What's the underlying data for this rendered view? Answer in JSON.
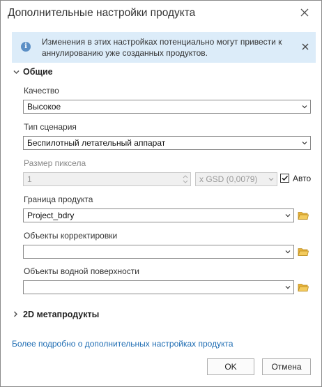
{
  "dialog": {
    "title": "Дополнительные настройки продукта",
    "close_icon": "close-icon"
  },
  "banner": {
    "icon": "info-icon",
    "text": "Изменения в этих настройках потенциально могут привести к аннулированию уже созданных продуктов.",
    "close_icon": "close-icon",
    "background": "#dcecf9"
  },
  "general": {
    "header": "Общие",
    "expanded": true,
    "quality": {
      "label": "Качество",
      "value": "Высокое"
    },
    "scenario": {
      "label": "Тип сценария",
      "value": "Беспилотный летательный аппарат"
    },
    "pixel_size": {
      "label": "Размер пиксела",
      "value": "1",
      "unit": "x GSD (0,0079)",
      "auto_label": "Авто",
      "auto_checked": true
    },
    "boundary": {
      "label": "Граница продукта",
      "value": "Project_bdry"
    },
    "correction": {
      "label": "Объекты корректировки",
      "value": ""
    },
    "water": {
      "label": "Объекты водной поверхности",
      "value": ""
    }
  },
  "metaproducts": {
    "header": "2D метапродукты",
    "expanded": false
  },
  "link_text": "Более подробно о дополнительных настройках продукта",
  "buttons": {
    "ok": "OK",
    "cancel": "Отмена"
  },
  "colors": {
    "link": "#1f6db3",
    "folder": "#e8b33a",
    "info": "#5b8fc5"
  }
}
